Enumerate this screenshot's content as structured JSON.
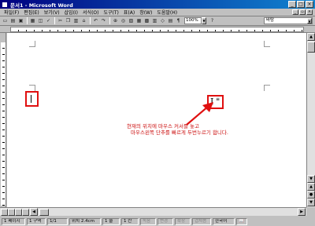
{
  "window": {
    "title": "문서1 - Microsoft Word"
  },
  "menu": [
    "파일(F)",
    "편집(E)",
    "보기(V)",
    "삽입(I)",
    "서식(O)",
    "도구(T)",
    "표(A)",
    "창(W)",
    "도움말(H)"
  ],
  "toolbar": {
    "zoom": "100%",
    "font": "바탕"
  },
  "annotation": {
    "line1": "현재의 위치에 마우스 커서를 놓고",
    "line2": "마우스왼쪽 단추를 빠르게 두번누르기 합니다."
  },
  "status": {
    "page": "1 페이지",
    "section": "1 구역",
    "pages": "1/1",
    "position": "위치 2.4cm",
    "line": "1 줄",
    "column": "1 칸",
    "modes": [
      "녹음",
      "변경",
      "확장",
      "겹쳐씀"
    ],
    "language": "한국어"
  },
  "colors": {
    "highlight": "#e01010",
    "titlebar": "#000080"
  }
}
